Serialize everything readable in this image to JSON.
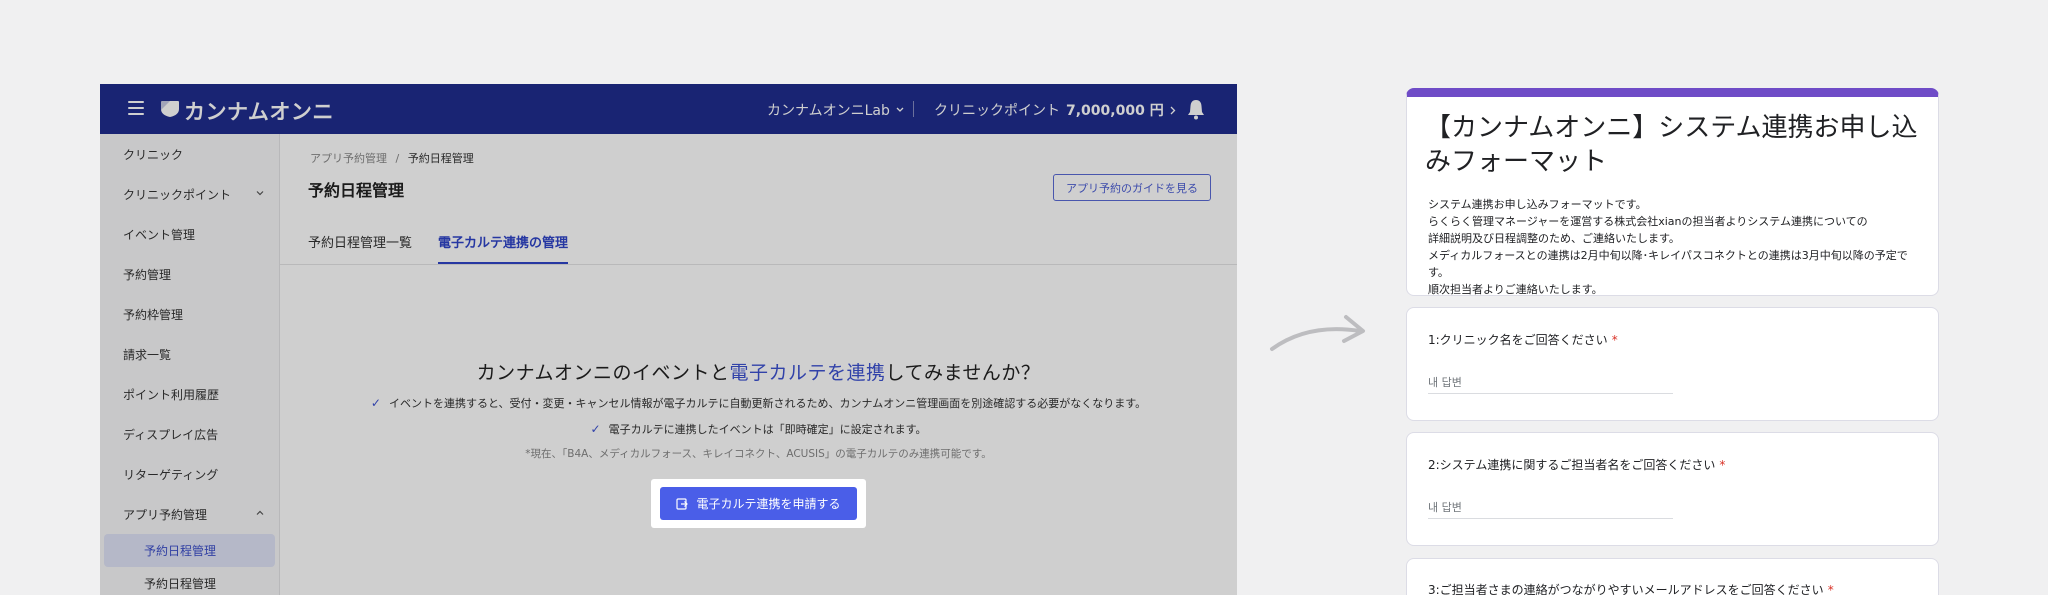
{
  "app": {
    "logo_text": "カンナムオンニ",
    "clinic_name": "カンナムオンニLab",
    "points_label": "クリニックポイント",
    "points_value": "7,000,000 円"
  },
  "sidebar": {
    "items": [
      {
        "label": "クリニック"
      },
      {
        "label": "クリニックポイント"
      },
      {
        "label": "イベント管理"
      },
      {
        "label": "予約管理"
      },
      {
        "label": "予約枠管理"
      },
      {
        "label": "請求一覧"
      },
      {
        "label": "ポイント利用履歴"
      },
      {
        "label": "ディスプレイ広告"
      },
      {
        "label": "リターゲティング"
      },
      {
        "label": "アプリ予約管理"
      }
    ],
    "sub_items": [
      {
        "label": "予約日程管理"
      },
      {
        "label": "予約日程管理"
      }
    ]
  },
  "main": {
    "breadcrumb_parent": "アプリ予約管理",
    "breadcrumb_sep": "/",
    "breadcrumb_current": "予約日程管理",
    "title": "予約日程管理",
    "guide_button": "アプリ予約のガイドを見る",
    "tabs": [
      {
        "label": "予約日程管理一覧"
      },
      {
        "label": "電子カルテ連携の管理"
      }
    ],
    "headline_pre": "カンナムオンニのイベントと",
    "headline_highlight": "電子カルテを連携",
    "headline_post": "してみませんか？",
    "bullets": [
      "イベントを連携すると、受付・変更・キャンセル情報が電子カルテに自動更新されるため、カンナムオンニ管理画面を別途確認する必要がなくなります。",
      "電子カルテに連携したイベントは「即時確定」に設定されます。"
    ],
    "note": "*現在、「B4A、メディカルフォース、キレイコネクト、ACUSIS」の電子カルテのみ連携可能です。",
    "cta_label": "電子カルテ連携を申請する"
  },
  "form": {
    "title": "【カンナムオンニ】システム連携お申し込みフォーマット",
    "description": [
      "システム連携お申し込みフォーマットです。",
      "らくらく管理マネージャーを運営する株式会社xianの担当者よりシステム連携についての",
      "詳細説明及び日程調整のため、ご連絡いたします。",
      "メディカルフォースとの連携は2月中旬以降･キレイパスコネクトとの連携は3月中旬以降の予定です。",
      "順次担当者よりご連絡いたします。"
    ],
    "questions": [
      {
        "label": "1:クリニック名をご回答ください",
        "required": "*",
        "placeholder": "내 답변"
      },
      {
        "label": "2:システム連携に関するご担当者名をご回答ください",
        "required": "*",
        "placeholder": "내 답변"
      },
      {
        "label": "3:ご担当者さまの連絡がつながりやすいメールアドレスをご回答ください",
        "required": "*",
        "placeholder": ""
      }
    ]
  },
  "colors": {
    "topbar": "#1f2d8e",
    "accent": "#4a5ee8",
    "form_accent": "#6f4cc7",
    "required": "#d93025"
  }
}
